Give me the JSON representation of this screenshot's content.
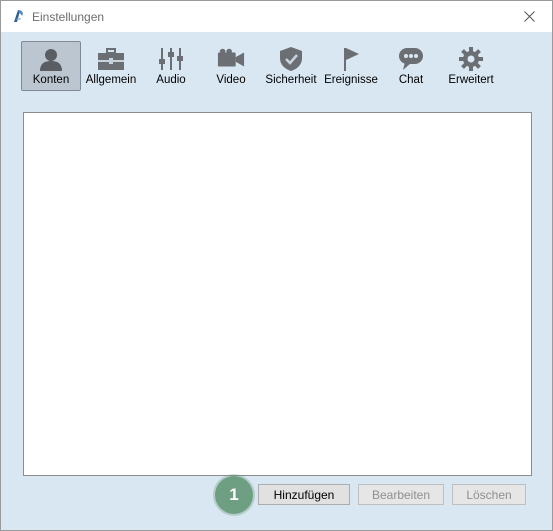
{
  "window": {
    "title": "Einstellungen"
  },
  "toolbar": {
    "items": [
      {
        "label": "Konten",
        "icon": "user-icon",
        "active": true
      },
      {
        "label": "Allgemein",
        "icon": "briefcase-icon",
        "active": false
      },
      {
        "label": "Audio",
        "icon": "audio-sliders-icon",
        "active": false
      },
      {
        "label": "Video",
        "icon": "video-camera-icon",
        "active": false
      },
      {
        "label": "Sicherheit",
        "icon": "shield-icon",
        "active": false
      },
      {
        "label": "Ereignisse",
        "icon": "flag-icon",
        "active": false
      },
      {
        "label": "Chat",
        "icon": "chat-bubble-icon",
        "active": false
      },
      {
        "label": "Erweitert",
        "icon": "gear-icon",
        "active": false
      }
    ]
  },
  "buttons": {
    "add_label": "Hinzufügen",
    "edit_label": "Bearbeiten",
    "delete_label": "Löschen"
  },
  "annotation": {
    "step_number": "1"
  },
  "colors": {
    "window_bg": "#d9e7f3",
    "active_tab_bg": "#bcc6d1",
    "badge": "#6f9f82",
    "icon_gray": "#6b6f74"
  }
}
